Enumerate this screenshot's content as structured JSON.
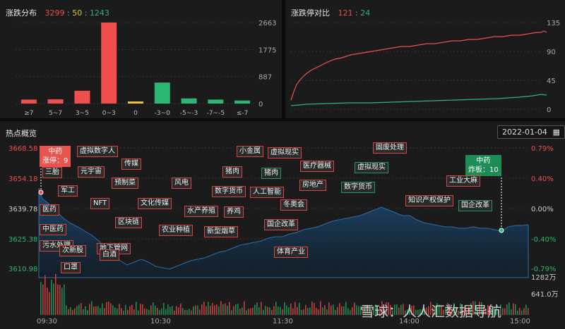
{
  "dist": {
    "title": "涨跌分布",
    "up": "3299",
    "sep1": ":",
    "flat": "50",
    "sep2": ":",
    "down": "1243",
    "yticks": [
      "2663",
      "1775",
      "887",
      "0"
    ],
    "categories": [
      "≥7",
      "5~7",
      "3~5",
      "0~3",
      "0",
      "-3~0",
      "-5~-3",
      "-7~-5",
      "≤-7"
    ],
    "values": [
      130,
      140,
      420,
      2663,
      50,
      690,
      170,
      130,
      100
    ],
    "colors": [
      "#ef4f4f",
      "#ef4f4f",
      "#ef4f4f",
      "#ef4f4f",
      "#e7c23a",
      "#2bb673",
      "#2bb673",
      "#2bb673",
      "#2bb673"
    ],
    "ylim": [
      0,
      2663
    ]
  },
  "limit": {
    "title": "涨跌停对比",
    "up": "121",
    "sep": ":",
    "down": "24",
    "yticks": [
      "135",
      "90",
      "45",
      "0"
    ]
  },
  "hot": {
    "title": "热点概览",
    "date": "2022-01-04",
    "calendar_icon": "calendar-icon",
    "left_ticks": [
      "3668.58",
      "3654.18",
      "3639.78",
      "3625.38",
      "3610.98"
    ],
    "right_ticks": [
      "0.79%",
      "0.40%",
      "0.00%",
      "-0.40%",
      "-0.79%"
    ],
    "vol_ticks": [
      "1282万",
      "641.0万"
    ],
    "time_ticks": [
      "09:30",
      "10:30",
      "11:30",
      "14:00",
      "15:00"
    ],
    "tip_up": {
      "line1": "中药",
      "line2": "涨停：9"
    },
    "tip_down": {
      "line1": "中药",
      "line2": "炸板：10"
    },
    "labels": [
      "虚拟数字人",
      "三胎",
      "元宇宙",
      "传媒",
      "军工",
      "预制菜",
      "NFT",
      "风电",
      "医药",
      "文化传媒",
      "区块链",
      "水产养殖",
      "中医药",
      "农业种植",
      "新型烟草",
      "污水处理",
      "次新股",
      "地下管网",
      "白酒",
      "口罩",
      "小金属",
      "虚拟现实",
      "猪肉",
      "猪肉",
      "人工智能",
      "数字货币",
      "养鸡",
      "冬奥会",
      "国企改革",
      "体育产业",
      "医疗器械",
      "房地产",
      "虚拟现实",
      "数字货币",
      "固废处理",
      "知识产权保护",
      "工业大麻",
      "国企改革"
    ]
  },
  "watermark": "雪球：人人汇数据导航",
  "colors": {
    "up": "#ef4f4f",
    "down": "#2bb673",
    "flat": "#e7c23a"
  }
}
